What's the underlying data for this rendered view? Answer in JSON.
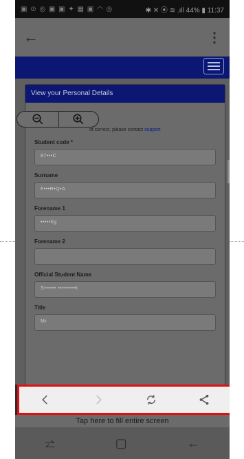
{
  "status_bar": {
    "left_icons": "▣ ⊙ ◎ ▣ ▣ ✦ ▦ ▣ ◠ ◎",
    "right_text": "✱ ✕ ⦿ ≋ .ıll 44% ▮ 11:37"
  },
  "appbar": {
    "back_icon": "arrow-left-icon",
    "menu_icon": "kebab-icon"
  },
  "page": {
    "card_title": "View your Personal Details",
    "notice_prefix": "ot correct, please contact ",
    "notice_link": "support",
    "fields": [
      {
        "label": "Student code *",
        "value": "87•••C"
      },
      {
        "label": "Surname",
        "value": "F•••R•Q•A"
      },
      {
        "label": "Forename 1",
        "value": "•••••hg"
      },
      {
        "label": "Forename 2",
        "value": ""
      },
      {
        "label": "Official Student Name",
        "value": "S•••••• •••••••••t"
      },
      {
        "label": "Title",
        "value": "Mr"
      }
    ]
  },
  "zoom": {
    "out_icon": "zoom-out-icon",
    "in_icon": "zoom-in-icon"
  },
  "browser_nav": {
    "back_icon": "chevron-left-icon",
    "forward_icon": "chevron-right-icon",
    "refresh_icon": "refresh-icon",
    "share_icon": "share-icon"
  },
  "fill_hint": "Tap here to fill entire screen",
  "android_nav": {
    "recent": "⥨",
    "home": "▢",
    "back": "←"
  }
}
